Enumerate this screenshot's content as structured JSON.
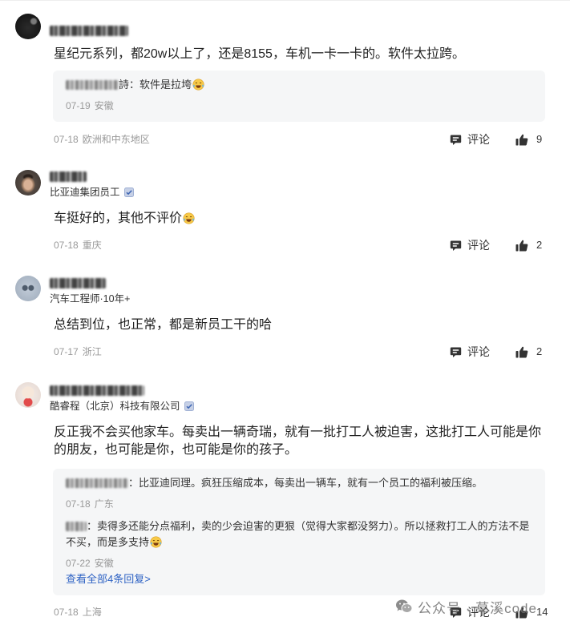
{
  "comments": [
    {
      "text": "星纪元系列，都20w以上了，还是8155，车机一卡一卡的。软件太拉跨。",
      "replies": [
        {
          "text": "詩：软件是拉垮",
          "emoji": "face-with-tears-of-joy-emoji",
          "date": "07-19",
          "location": "安徽"
        }
      ],
      "date": "07-18",
      "location": "欧洲和中东地区",
      "comment_label": "评论",
      "like_count": "9"
    },
    {
      "subtitle": "比亚迪集团员工",
      "badge_icon": "verified-badge-icon",
      "text": "车挺好的，其他不评价",
      "emoji": "face-with-tears-of-joy-emoji",
      "date": "07-18",
      "location": "重庆",
      "comment_label": "评论",
      "like_count": "2"
    },
    {
      "subtitle": "汽车工程师·10年+",
      "text": "总结到位，也正常，都是新员工干的哈",
      "date": "07-17",
      "location": "浙江",
      "comment_label": "评论",
      "like_count": "2"
    },
    {
      "subtitle": "酷睿程（北京）科技有限公司",
      "badge_icon": "verified-badge-icon",
      "text": "反正我不会买他家车。每卖出一辆奇瑞，就有一批打工人被迫害，这批打工人可能是你的朋友，也可能是你，也可能是你的孩子。",
      "replies": [
        {
          "text": "：比亚迪同理。疯狂压缩成本，每卖出一辆车，就有一个员工的福利被压缩。",
          "date": "07-18",
          "location": "广东"
        },
        {
          "text": "：卖得多还能分点福利，卖的少会迫害的更狠（觉得大家都没努力）。所以拯救打工人的方法不是不买，而是多支持",
          "emoji": "face-with-tears-of-joy-emoji",
          "date": "07-22",
          "location": "安徽"
        }
      ],
      "more_replies": "查看全部4条回复>",
      "date": "07-18",
      "location": "上海",
      "comment_label": "评论",
      "like_count": "14"
    }
  ],
  "icons": {
    "comment": "comment-bubble-icon",
    "like": "thumbs-up-icon"
  },
  "watermark": {
    "icon": "wechat-icon",
    "text": "公众号 · 草溪code"
  },
  "colors": {
    "meta_gray": "#999999",
    "link_blue": "#2f63c4",
    "reply_background": "#f5f6f7",
    "text_dark": "#222222"
  }
}
